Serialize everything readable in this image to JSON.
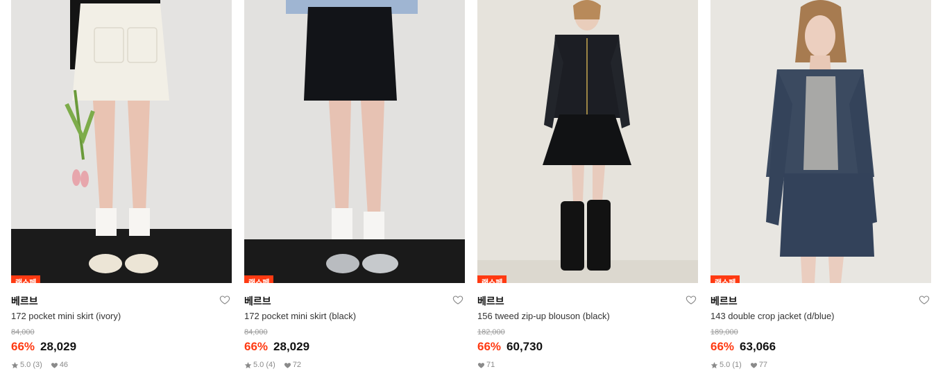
{
  "colors": {
    "accent": "#ff3a12",
    "badge_text": "#ffffff"
  },
  "products": [
    {
      "badge": "랜쇼페",
      "brand": "베르브",
      "title": "172 pocket mini skirt (ivory)",
      "original_price": "84,000",
      "discount": "66%",
      "price": "28,029",
      "rating": "5.0",
      "reviews": "(3)",
      "likes": "46",
      "image_icon": "product-photo-ivory-skirt"
    },
    {
      "badge": "랜쇼페",
      "brand": "베르브",
      "title": "172 pocket mini skirt (black)",
      "original_price": "84,000",
      "discount": "66%",
      "price": "28,029",
      "rating": "5.0",
      "reviews": "(4)",
      "likes": "72",
      "image_icon": "product-photo-black-skirt"
    },
    {
      "badge": "랜쇼페",
      "brand": "베르브",
      "title": "156 tweed zip-up blouson (black)",
      "original_price": "182,000",
      "discount": "66%",
      "price": "60,730",
      "rating": "",
      "reviews": "",
      "likes": "71",
      "image_icon": "product-photo-tweed-blouson"
    },
    {
      "badge": "랜쇼페",
      "brand": "베르브",
      "title": "143 double crop jacket (d/blue)",
      "original_price": "189,000",
      "discount": "66%",
      "price": "63,066",
      "rating": "5.0",
      "reviews": "(1)",
      "likes": "77",
      "image_icon": "product-photo-crop-jacket"
    }
  ]
}
